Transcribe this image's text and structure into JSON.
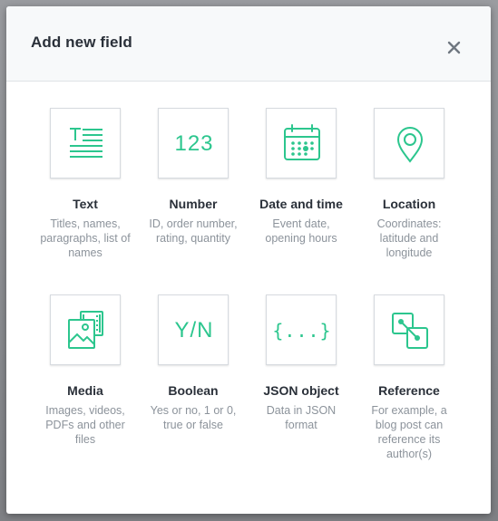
{
  "dialog": {
    "title": "Add new field",
    "close_glyph": "×"
  },
  "accent_color": "#2cc68e",
  "field_types": [
    {
      "icon": "text-lines-icon",
      "name": "Text",
      "description": "Titles, names, paragraphs, list of names"
    },
    {
      "icon": "number-icon",
      "glyph": "123",
      "name": "Number",
      "description": "ID, order number, rating, quantity"
    },
    {
      "icon": "calendar-icon",
      "name": "Date and time",
      "description": "Event date, opening hours"
    },
    {
      "icon": "location-pin-icon",
      "name": "Location",
      "description": "Coordinates: latitude and longitude"
    },
    {
      "icon": "media-images-icon",
      "name": "Media",
      "description": "Images, videos, PDFs and other files"
    },
    {
      "icon": "boolean-icon",
      "glyph": "Y/N",
      "name": "Boolean",
      "description": "Yes or no, 1 or 0, true or false"
    },
    {
      "icon": "json-braces-icon",
      "glyph": "{...}",
      "name": "JSON object",
      "description": "Data in JSON format"
    },
    {
      "icon": "reference-link-icon",
      "name": "Reference",
      "description": "For example, a blog post can reference its author(s)"
    }
  ]
}
